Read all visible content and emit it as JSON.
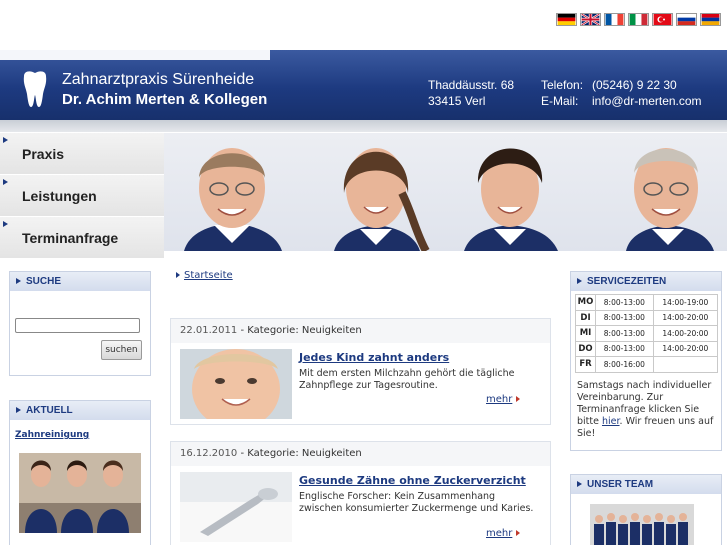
{
  "flags": [
    {
      "name": "german-flag-icon",
      "colors": [
        "#000000",
        "#dd0000",
        "#ffce00"
      ]
    },
    {
      "name": "uk-flag-icon",
      "colors": [
        "#012169",
        "#ffffff",
        "#c8102e"
      ]
    },
    {
      "name": "french-flag-icon",
      "colors": [
        "#0055a4",
        "#ffffff",
        "#ef4135"
      ]
    },
    {
      "name": "italian-flag-icon",
      "colors": [
        "#009246",
        "#ffffff",
        "#ce2b37"
      ]
    },
    {
      "name": "turkish-flag-icon",
      "colors": [
        "#e30a17",
        "#ffffff"
      ]
    },
    {
      "name": "russian-flag-icon",
      "colors": [
        "#ffffff",
        "#0039a6",
        "#d52b1e"
      ]
    },
    {
      "name": "armenian-flag-icon",
      "colors": [
        "#d90012",
        "#0033a0",
        "#f2a800"
      ]
    }
  ],
  "header": {
    "name_line1": "Zahnarztpraxis Sürenheide",
    "name_line2": "Dr. Achim Merten & Kollegen",
    "street": "Thaddäusstr. 68",
    "city": "33415 Verl",
    "phone_label": "Telefon:",
    "phone": "(05246) 9 22 30",
    "email_label": "E-Mail:",
    "email": "info@dr-merten.com"
  },
  "nav": {
    "items": [
      {
        "label": "Praxis"
      },
      {
        "label": "Leistungen"
      },
      {
        "label": "Terminanfrage"
      }
    ]
  },
  "search": {
    "title": "SUCHE",
    "button": "suchen",
    "value": ""
  },
  "aktuell": {
    "title": "AKTUELL",
    "link": "Zahnreinigung"
  },
  "breadcrumb": {
    "label": "Startseite"
  },
  "articles": [
    {
      "date": "22.01.2011",
      "category": " - Kategorie: Neuigkeiten",
      "title": "Jedes Kind zahnt anders",
      "text": "Mit dem ersten Milchzahn gehört die tägliche Zahnpflege zur Tagesroutine.",
      "more": "mehr"
    },
    {
      "date": "16.12.2010",
      "category": " - Kategorie: Neuigkeiten",
      "title": "Gesunde Zähne ohne Zuckerverzicht",
      "text": "Englische Forscher: Kein Zusammenhang zwischen konsumierter Zuckermenge und Karies.",
      "more": "mehr"
    }
  ],
  "service": {
    "title": "SERVICEZEITEN",
    "rows": [
      {
        "day": "MO",
        "am": "8:00-13:00",
        "pm": "14:00-19:00"
      },
      {
        "day": "DI",
        "am": "8:00-13:00",
        "pm": "14:00-20:00"
      },
      {
        "day": "MI",
        "am": "8:00-13:00",
        "pm": "14:00-20:00"
      },
      {
        "day": "DO",
        "am": "8:00-13:00",
        "pm": "14:00-20:00"
      },
      {
        "day": "FR",
        "am": "8:00-16:00",
        "pm": ""
      }
    ],
    "note_before": "Samstags nach individueller Vereinbarung. Zur Terminanfrage klicken Sie bitte ",
    "note_link": "hier",
    "note_after": ". Wir freuen uns auf Sie!"
  },
  "team": {
    "title": "UNSER TEAM"
  },
  "colors": {
    "brand_blue": "#1d3a80",
    "header_top": "#3b5aa0",
    "accent_red": "#c0392b"
  }
}
